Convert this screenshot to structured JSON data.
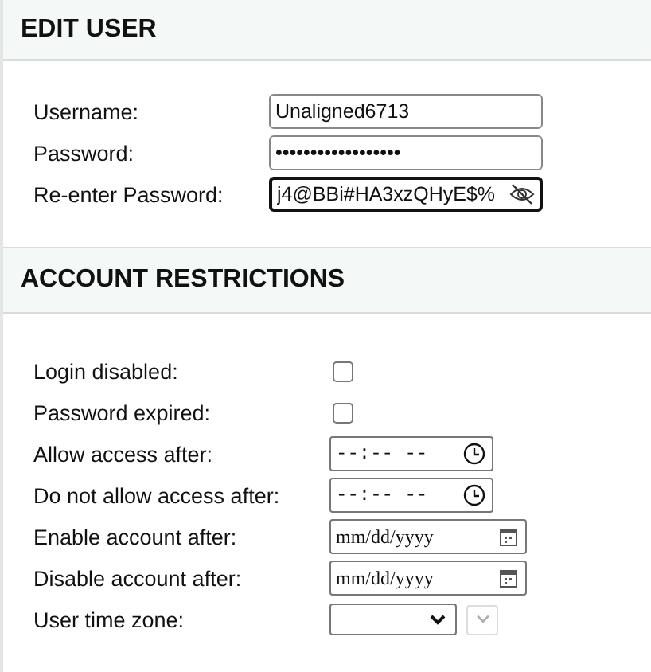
{
  "edit_user": {
    "title": "EDIT USER",
    "fields": [
      {
        "label": "Username:",
        "value": "Unaligned6713",
        "focused": false,
        "reveal_icon": false
      },
      {
        "label": "Password:",
        "value": "••••••••••••••••••",
        "focused": false,
        "reveal_icon": false
      },
      {
        "label": "Re-enter Password:",
        "value": "j4@BBi#HA3xzQHyE$%",
        "focused": true,
        "reveal_icon": true
      }
    ]
  },
  "account_restrictions": {
    "title": "ACCOUNT RESTRICTIONS",
    "rows": [
      {
        "kind": "checkbox",
        "label": "Login disabled:",
        "checked": false
      },
      {
        "kind": "checkbox",
        "label": "Password expired:",
        "checked": false
      },
      {
        "kind": "time",
        "label": "Allow access after:",
        "placeholder": "--:-- --"
      },
      {
        "kind": "time",
        "label": "Do not allow access after:",
        "placeholder": "--:-- --"
      },
      {
        "kind": "date",
        "label": "Enable account after:",
        "placeholder": "mm/dd/yyyy"
      },
      {
        "kind": "date",
        "label": "Disable account after:",
        "placeholder": "mm/dd/yyyy"
      },
      {
        "kind": "select",
        "label": "User time zone:",
        "extra_disabled": true
      }
    ]
  }
}
